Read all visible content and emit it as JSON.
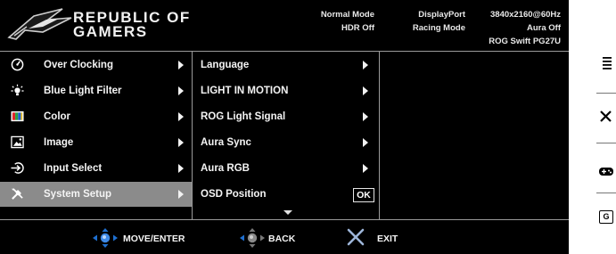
{
  "brand": {
    "line1": "REPUBLIC OF",
    "line2": "GAMERS"
  },
  "status": {
    "mode": "Normal Mode",
    "hdr": "HDR Off",
    "input": "DisplayPort",
    "preset": "Racing Mode",
    "resolution": "3840x2160@60Hz",
    "aura": "Aura Off",
    "model": "ROG Swift PG27U"
  },
  "main_menu": [
    {
      "label": "Over Clocking",
      "icon": "overclock-gauge-icon"
    },
    {
      "label": "Blue Light Filter",
      "icon": "light-bulb-icon"
    },
    {
      "label": "Color",
      "icon": "color-palette-icon"
    },
    {
      "label": "Image",
      "icon": "image-icon"
    },
    {
      "label": "Input Select",
      "icon": "input-arrow-icon"
    },
    {
      "label": "System Setup",
      "icon": "wrench-screwdriver-icon",
      "selected": true
    }
  ],
  "submenu": [
    {
      "label": "Language"
    },
    {
      "label": "LIGHT IN MOTION"
    },
    {
      "label": "ROG Light Signal"
    },
    {
      "label": "Aura Sync"
    },
    {
      "label": "Aura RGB"
    },
    {
      "label": "OSD Position",
      "value": "OK"
    }
  ],
  "footer": {
    "move_label": "MOVE/ENTER",
    "back_label": "BACK",
    "exit_label": "EXIT"
  },
  "side_buttons": [
    "menu-icon",
    "close-icon",
    "gamepad-icon",
    "gameplus-icon"
  ],
  "side_gameplus_text": "G",
  "colors": {
    "background": "#000000",
    "selected_row": "#8b8b8b",
    "divider": "#9a9a9a",
    "nav_blue": "#1e6fd0",
    "exit_x": "#9db5d8"
  }
}
